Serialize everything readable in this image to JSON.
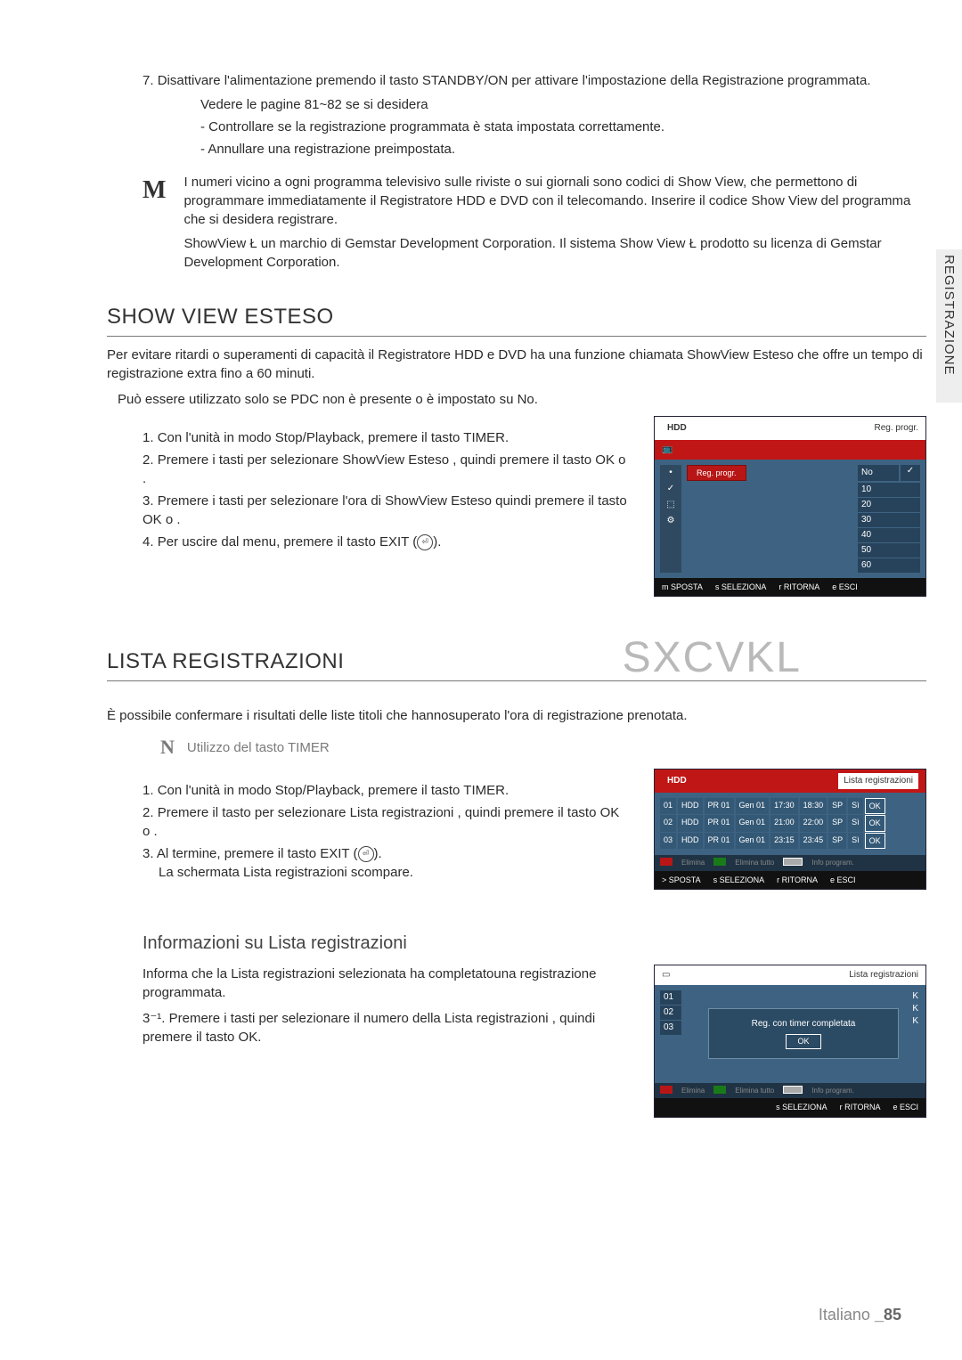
{
  "step7_num": "7.",
  "step7": "Disattivare l'alimentazione premendo il tasto STANDBY/ON per attivare l'impostazione della Registrazione programmata.",
  "step7_sub1": "Vedere le pagine 81~82 se si desidera",
  "step7_sub2": "- Controllare se la registrazione programmata è stata impostata correttamente.",
  "step7_sub3": "- Annullare una registrazione preimpostata.",
  "note_icon": "M",
  "note_p1": "I numeri vicino a ogni programma televisivo sulle riviste o sui giornali sono codici di Show View, che permettono di programmare immediatamente il Registratore HDD e DVD con il telecomando. Inserire il codice Show View del programma che si desidera registrare.",
  "note_p2": "ShowView Ł un marchio di Gemstar Development Corporation. Il sistema Show View Ł prodotto su licenza di Gemstar Development Corporation.",
  "h2_a": "SHOW VIEW ESTESO",
  "intro_a1": "Per evitare ritardi o superamenti di capacità il Registratore HDD e DVD ha una funzione chiamata ShowView Esteso che offre un tempo di registrazione extra fino a 60 minuti.",
  "intro_a2": "Può essere utilizzato solo se PDC non è presente o è impostato su No.",
  "sve_1n": "1.",
  "sve_1": "Con l'unità in modo Stop/Playback, premere il tasto TIMER.",
  "sve_2n": "2.",
  "sve_2": "Premere i tasti       per selezionare ShowView Esteso , quindi premere il tasto OK o    .",
  "sve_3n": "3.",
  "sve_3": "Premere i tasti       per selezionare l'ora di ShowView Esteso quindi premere il tasto OK o    .",
  "sve_4n": "4.",
  "sve_4": "Per uscire dal menu, premere il tasto EXIT (",
  "sve_4_tail": ").",
  "osd1_title": "Reg. progr.",
  "osd1_hdd": "HDD",
  "osd1_chip": "Reg. progr.",
  "osd1_col_no": "No",
  "osd1_check": "✓",
  "osd1_vals": [
    "10",
    "20",
    "30",
    "40",
    "50",
    "60"
  ],
  "osd1_bar": {
    "m": "m  SPOSTA",
    "s": "s  SELEZIONA",
    "r": "r  RITORNA",
    "e": "e  ESCI"
  },
  "h2_b": "LISTA REGISTRAZIONI",
  "watermark": "SXCVKL",
  "intro_b": "È possibile confermare i risultati delle liste titoli che hannosuperato l'ora di registrazione prenotata.",
  "tip_icon": "N",
  "tip_txt": "Utilizzo del tasto TIMER",
  "lr_1n": "1.",
  "lr_1": "Con l'unità in modo Stop/Playback, premere il tasto TIMER.",
  "lr_2n": "2.",
  "lr_2": "Premere il tasto       per selezionare Lista registrazioni , quindi premere il tasto OK o    .",
  "lr_3n": "3.",
  "lr_3a": "Al termine, premere il tasto EXIT (",
  "lr_3b": ").",
  "lr_3c": "La schermata Lista registrazioni scompare.",
  "osd2_title": "Lista registrazioni",
  "osd2_hdd": "HDD",
  "osd2_rows": [
    {
      "n": "01",
      "d": "HDD",
      "pr": "PR 01",
      "dt": "Gen 01",
      "t1": "17:30",
      "t2": "18:30",
      "sp": "SP",
      "si": "Sì",
      "ok": "OK"
    },
    {
      "n": "02",
      "d": "HDD",
      "pr": "PR 01",
      "dt": "Gen 01",
      "t1": "21:00",
      "t2": "22:00",
      "sp": "SP",
      "si": "Sì",
      "ok": "OK"
    },
    {
      "n": "03",
      "d": "HDD",
      "pr": "PR 01",
      "dt": "Gen 01",
      "t1": "23:15",
      "t2": "23:45",
      "sp": "SP",
      "si": "Sì",
      "ok": "OK"
    }
  ],
  "osd2_btns": {
    "a": "Elimina",
    "b": "Elimina tutto",
    "g": "Info program."
  },
  "osd2_bar": {
    "m": ">  SPOSTA",
    "s": "s  SELEZIONA",
    "r": "r  RITORNA",
    "e": "e  ESCI"
  },
  "h3_c": "Informazioni su Lista registrazioni",
  "info_p": "Informa che la Lista registrazioni selezionata ha completatouna registrazione programmata.",
  "info_3n": "3⁻¹.",
  "info_3": "Premere i tasti        per selezionare il numero della Lista registrazioni , quindi premere il tasto OK.",
  "osd3_title": "Lista registrazioni",
  "osd3_rows": [
    "01",
    "02",
    "03"
  ],
  "osd3_msg": "Reg. con timer completata",
  "osd3_ok": "OK",
  "osd3_k": "K",
  "osd3_btns": {
    "a": "Elimina",
    "b": "Elimina tutto",
    "g": "Info program."
  },
  "osd3_bar": {
    "s": "s  SELEZIONA",
    "r": "r  RITORNA",
    "e": "e  ESCI"
  },
  "side_tab": "REGISTRAZIONE",
  "footer_lang": "Italiano",
  "footer_pg": "_85"
}
